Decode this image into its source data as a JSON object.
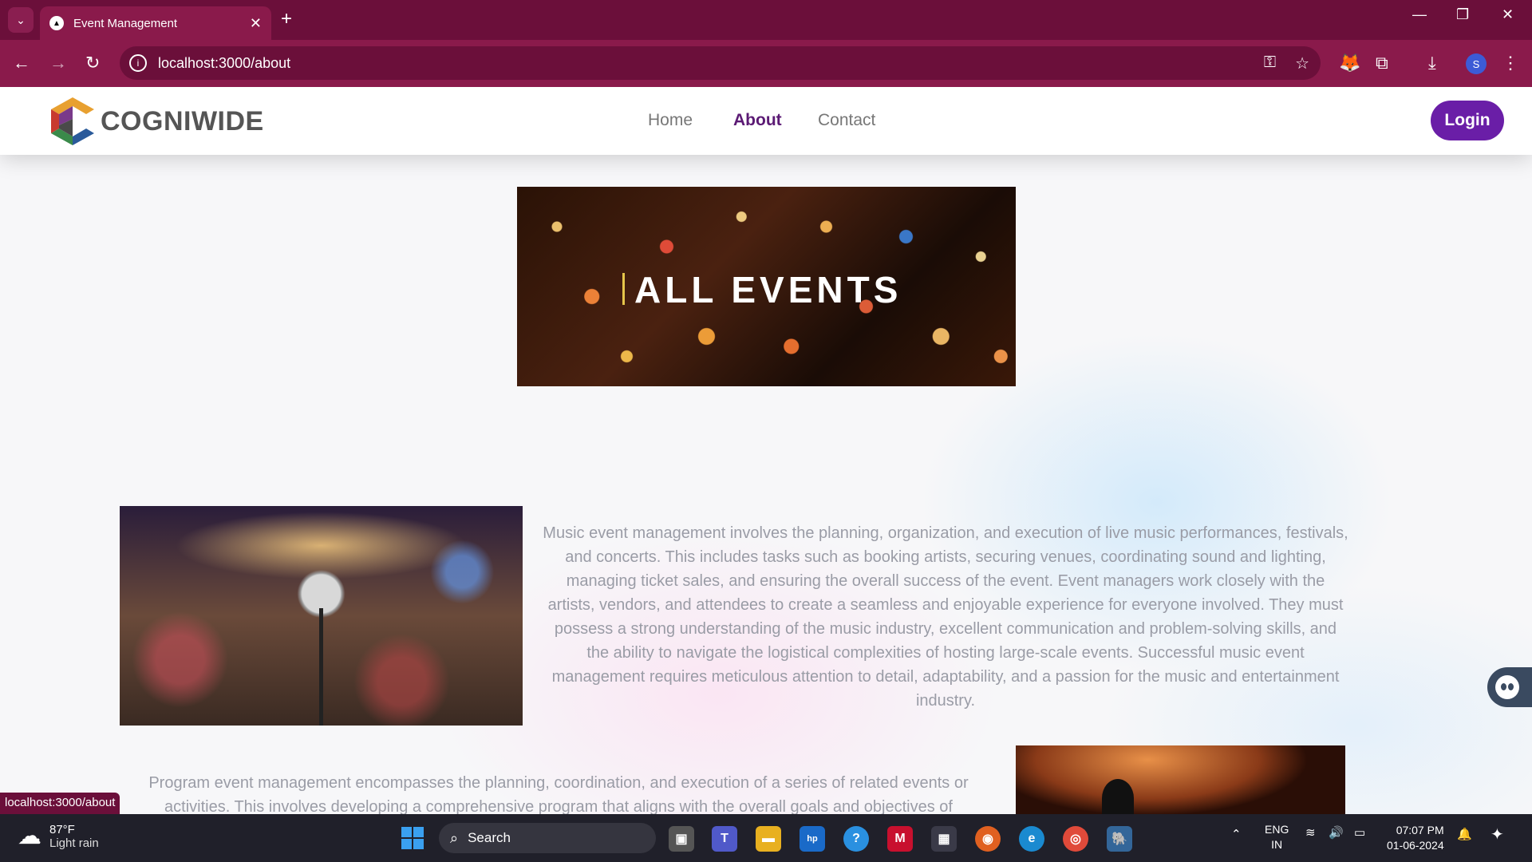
{
  "browser": {
    "tab_title": "Event Management",
    "url": "localhost:3000/about",
    "status_url": "localhost:3000/about",
    "profile_initial": "S"
  },
  "site": {
    "logo_text": "COGNIWIDE",
    "nav": [
      {
        "label": "Home",
        "active": false
      },
      {
        "label": "About",
        "active": true
      },
      {
        "label": "Contact",
        "active": false
      }
    ],
    "login_label": "Login"
  },
  "banner": {
    "text": "ALL EVENTS"
  },
  "content": {
    "para1": "Music event management involves the planning, organization, and execution of live music performances, festivals, and concerts. This includes tasks such as booking artists, securing venues, coordinating sound and lighting, managing ticket sales, and ensuring the overall success of the event. Event managers work closely with the artists, vendors, and attendees to create a seamless and enjoyable experience for everyone involved. They must possess a strong understanding of the music industry, excellent communication and problem-solving skills, and the ability to navigate the logistical complexities of hosting large-scale events. Successful music event management requires meticulous attention to detail, adaptability, and a passion for the music and entertainment industry.",
    "para2": "Program event management encompasses the planning, coordination, and execution of a series of related events or activities. This involves developing a comprehensive program that aligns with the overall goals and objectives of"
  },
  "taskbar": {
    "weather_temp": "87°F",
    "weather_desc": "Light rain",
    "search_label": "Search",
    "lang_top": "ENG",
    "lang_bottom": "IN",
    "time": "07:07 PM",
    "date": "01-06-2024"
  },
  "colors": {
    "browser_frame": "#6b0f3a",
    "accent": "#6a1ea7",
    "nav_active": "#5b1a74"
  }
}
